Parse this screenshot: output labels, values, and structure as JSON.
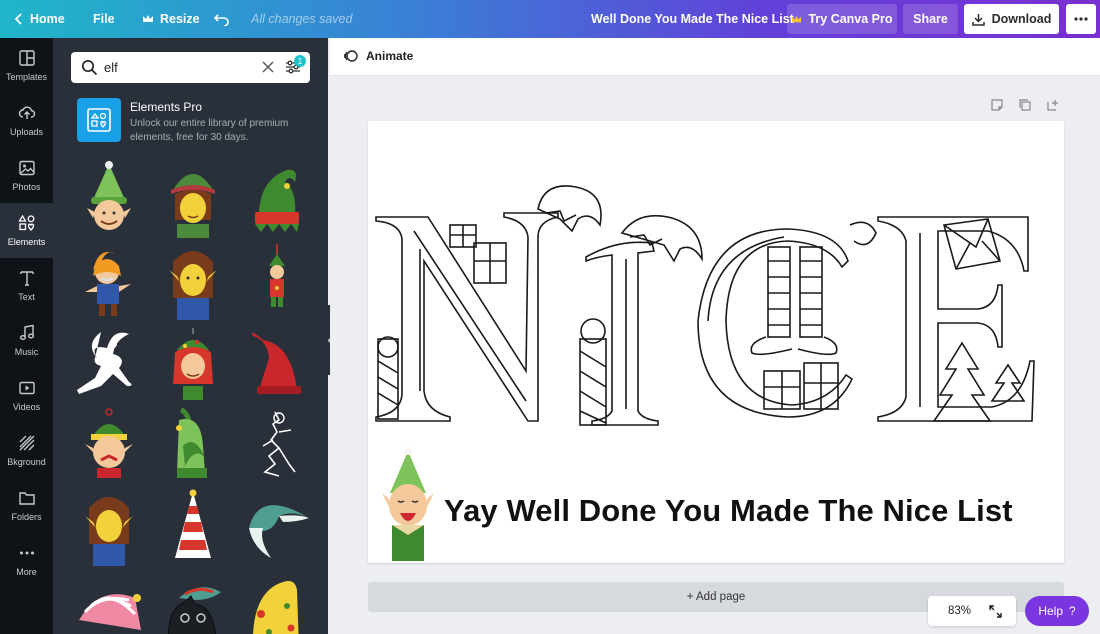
{
  "topbar": {
    "home_label": "Home",
    "file_label": "File",
    "resize_label": "Resize",
    "saved_status": "All changes saved",
    "document_title": "Well Done You Made The Nice List",
    "try_pro_label": "Try Canva Pro",
    "share_label": "Share",
    "download_label": "Download"
  },
  "rail": {
    "items": [
      {
        "label": "Templates",
        "icon": "layout-icon"
      },
      {
        "label": "Uploads",
        "icon": "upload-cloud-icon"
      },
      {
        "label": "Photos",
        "icon": "image-icon"
      },
      {
        "label": "Elements",
        "icon": "shapes-icon"
      },
      {
        "label": "Text",
        "icon": "text-icon"
      },
      {
        "label": "Music",
        "icon": "music-icon"
      },
      {
        "label": "Videos",
        "icon": "video-icon"
      },
      {
        "label": "Bkground",
        "icon": "background-icon"
      },
      {
        "label": "Folders",
        "icon": "folder-icon"
      },
      {
        "label": "More",
        "icon": "more-icon"
      }
    ],
    "active": "Elements"
  },
  "panel": {
    "search_value": "elf",
    "filter_count": "1",
    "promo_title": "Elements Pro",
    "promo_desc": "Unlock our entire library of premium elements, free for 30 days.",
    "results": [
      "elf-boy-green-hat",
      "elf-girl-green-hat",
      "green-elf-hat",
      "elf-orange-hair",
      "elf-girl-plain",
      "elf-ornament",
      "fairy-silhouette",
      "elf-girl-red-hair",
      "red-elf-hat",
      "elf-head-ornament",
      "green-hat-ornament",
      "elf-sketch",
      "elf-girl-plain-2",
      "striped-party-hat",
      "teal-sleeping-cap",
      "striped-pink-hat",
      "cat-with-hat",
      "yellow-elf-hat"
    ]
  },
  "canvas": {
    "animate_label": "Animate",
    "headline": "Yay Well Done You Made The Nice List",
    "nice_letters": [
      "N",
      "I",
      "C",
      "E"
    ],
    "add_page_label": "+ Add page",
    "zoom_value": "83%",
    "help_label": "Help",
    "help_icon": "?"
  },
  "colors": {
    "accent_purple": "#7a35e0",
    "rail_bg": "#0e1318",
    "panel_bg": "#293039",
    "pro_blue": "#1aa0e6"
  }
}
